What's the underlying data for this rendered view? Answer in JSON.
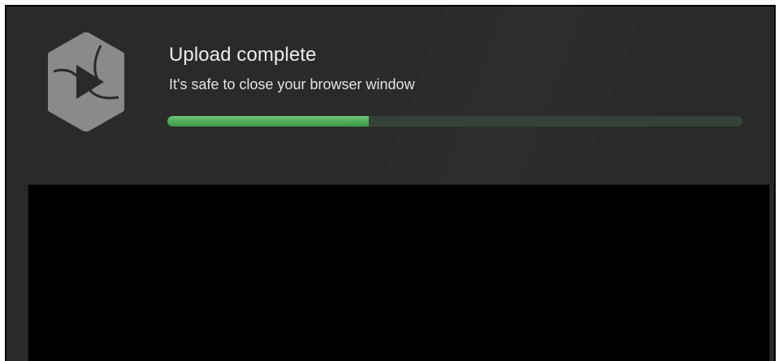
{
  "upload": {
    "title": "Upload complete",
    "message": "It's safe to close your browser window",
    "progress_percent": 35
  },
  "logo": {
    "icon": "panopto-logo-icon",
    "color": "#8a8a8a"
  },
  "colors": {
    "background": "#2a2a2a",
    "progress_fill": "#4caa55",
    "progress_track": "#34423a",
    "video_background": "#000000"
  }
}
